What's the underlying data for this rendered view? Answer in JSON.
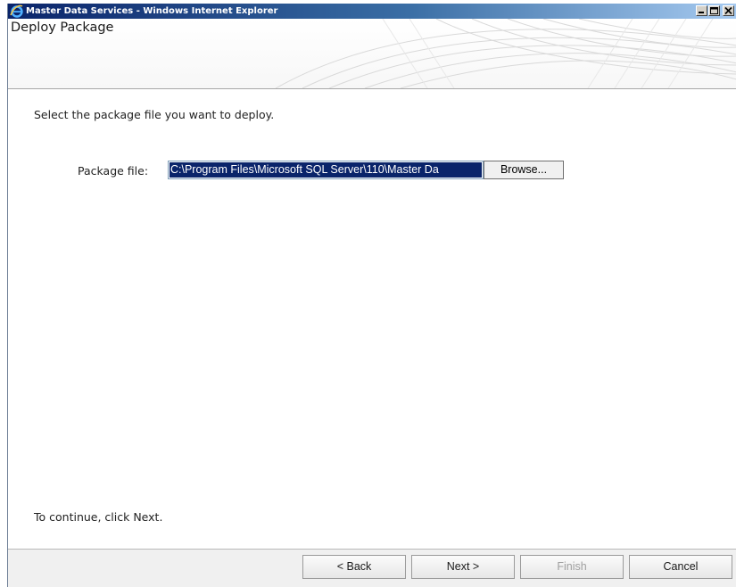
{
  "window": {
    "title": "Master Data Services - Windows Internet Explorer"
  },
  "header": {
    "title": "Deploy Package"
  },
  "main": {
    "instruction": "Select the package file you want to deploy.",
    "package_file_label": "Package file:",
    "package_file_value": "C:\\Program Files\\Microsoft SQL Server\\110\\Master Da",
    "browse_label": "Browse...",
    "continue_text": "To continue, click Next."
  },
  "footer": {
    "back_label": "< Back",
    "next_label": "Next >",
    "finish_label": "Finish",
    "cancel_label": "Cancel",
    "finish_enabled": false
  },
  "icons": {
    "app": "internet-explorer-icon",
    "minimize": "minimize-icon",
    "maximize": "maximize-icon",
    "close": "close-icon"
  },
  "colors": {
    "titlebar_start": "#0a246a",
    "titlebar_end": "#a6caf0",
    "selection": "#0a246a"
  }
}
